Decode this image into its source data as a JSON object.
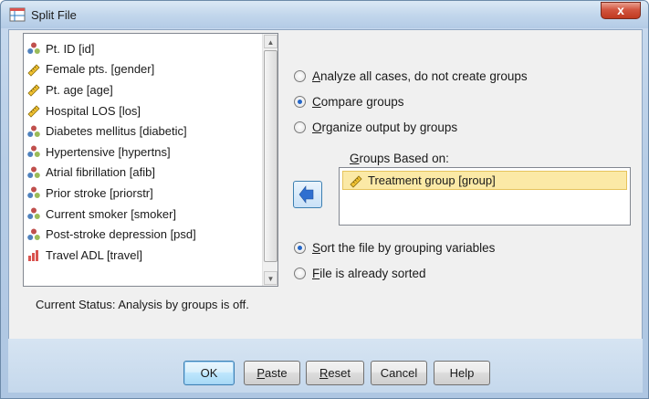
{
  "window": {
    "title": "Split File",
    "close_label": "x"
  },
  "variables": {
    "items": [
      {
        "label": "Pt. ID [id]",
        "icon": "nominal-icon"
      },
      {
        "label": "Female pts. [gender]",
        "icon": "scale-icon"
      },
      {
        "label": "Pt. age [age]",
        "icon": "scale-icon"
      },
      {
        "label": "Hospital LOS [los]",
        "icon": "scale-icon"
      },
      {
        "label": "Diabetes mellitus [diabetic]",
        "icon": "nominal-icon"
      },
      {
        "label": "Hypertensive [hypertns]",
        "icon": "nominal-icon"
      },
      {
        "label": "Atrial fibrillation [afib]",
        "icon": "nominal-icon"
      },
      {
        "label": "Prior stroke [priorstr]",
        "icon": "nominal-icon"
      },
      {
        "label": "Current smoker [smoker]",
        "icon": "nominal-icon"
      },
      {
        "label": "Post-stroke depression [psd]",
        "icon": "nominal-icon"
      },
      {
        "label": "Travel ADL [travel]",
        "icon": "ordinal-icon"
      }
    ]
  },
  "grouping_options": {
    "analyze_all": {
      "prefix": "",
      "mnemonic": "A",
      "rest": "nalyze all cases, do not create groups",
      "checked": false
    },
    "compare": {
      "prefix": "",
      "mnemonic": "C",
      "rest": "ompare groups",
      "checked": true
    },
    "organize": {
      "prefix": "",
      "mnemonic": "O",
      "rest": "rganize output by groups",
      "checked": false
    }
  },
  "groups_based_on": {
    "label_mnemonic": "G",
    "label_rest": "roups Based on:",
    "items": [
      {
        "label": "Treatment group [group]",
        "icon": "scale-icon"
      }
    ]
  },
  "sort_options": {
    "sort": {
      "mnemonic": "S",
      "rest": "ort the file by grouping variables",
      "checked": true
    },
    "already": {
      "mnemonic": "F",
      "rest": "ile is already sorted",
      "checked": false
    }
  },
  "status": {
    "text": "Current Status: Analysis by groups is off."
  },
  "buttons": {
    "ok": "OK",
    "paste_mn": "P",
    "paste_rest": "aste",
    "reset_mn": "R",
    "reset_rest": "eset",
    "cancel": "Cancel",
    "help": "Help"
  },
  "colors": {
    "selection": "#fbe9a6",
    "radio_dot": "#2466c8",
    "close_button": "#c0391f"
  }
}
